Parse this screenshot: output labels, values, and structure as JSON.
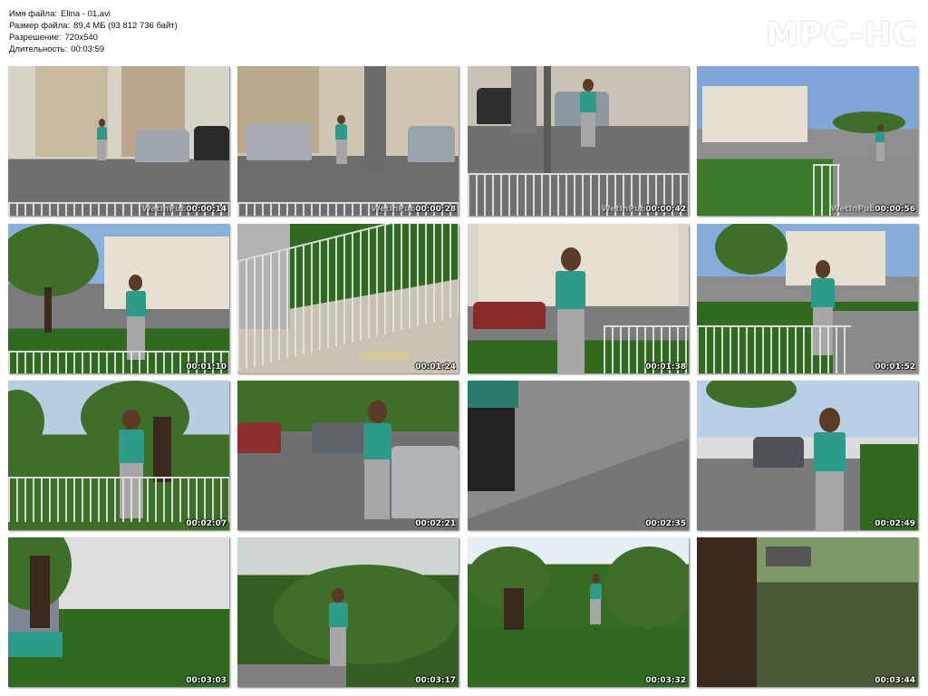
{
  "info": {
    "filename_label": "Имя файла:",
    "filename_value": "Elina - 01.avi",
    "filesize_label": "Размер файла:",
    "filesize_value": "89,4 МБ (93 812 736 байт)",
    "resolution_label": "Разрешение:",
    "resolution_value": "720x540",
    "duration_label": "Длительность:",
    "duration_value": "00:03:59"
  },
  "logo": "MPC-HC",
  "watermark": "WetInPubl",
  "thumbs": [
    {
      "time": "00:00:14",
      "watermark": true,
      "scene": "plaza-arch"
    },
    {
      "time": "00:00:28",
      "watermark": true,
      "scene": "plaza-cars"
    },
    {
      "time": "00:00:42",
      "watermark": true,
      "scene": "plaza-walk"
    },
    {
      "time": "00:00:56",
      "watermark": true,
      "scene": "arch-distance"
    },
    {
      "time": "00:01:10",
      "watermark": false,
      "scene": "arch-tree"
    },
    {
      "time": "00:01:24",
      "watermark": false,
      "scene": "legs-fence"
    },
    {
      "time": "00:01:38",
      "watermark": false,
      "scene": "arch-close"
    },
    {
      "time": "00:01:52",
      "watermark": false,
      "scene": "arch-path"
    },
    {
      "time": "00:02:07",
      "watermark": false,
      "scene": "park-fence"
    },
    {
      "time": "00:02:21",
      "watermark": false,
      "scene": "street-cars"
    },
    {
      "time": "00:02:35",
      "watermark": false,
      "scene": "asphalt-legs"
    },
    {
      "time": "00:02:49",
      "watermark": false,
      "scene": "street-back"
    },
    {
      "time": "00:03:03",
      "watermark": false,
      "scene": "tree-walk"
    },
    {
      "time": "00:03:17",
      "watermark": false,
      "scene": "bush-crouch"
    },
    {
      "time": "00:03:32",
      "watermark": false,
      "scene": "park-far"
    },
    {
      "time": "00:03:44",
      "watermark": false,
      "scene": "tree-close"
    }
  ],
  "colors": {
    "background": "#ffffff",
    "timestamp": "#ffffff",
    "shirt": "#2d9a8a"
  }
}
